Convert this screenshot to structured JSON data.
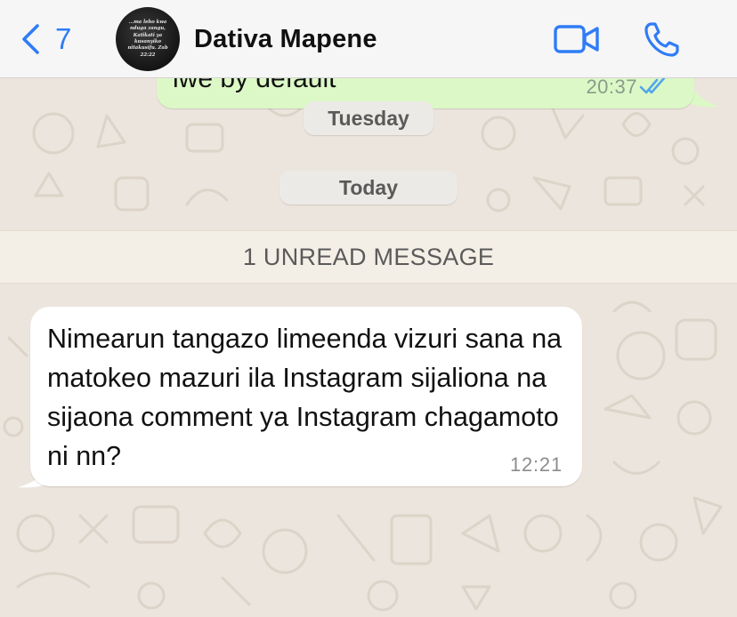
{
  "header": {
    "back_count": "7",
    "contact_name": "Dativa Mapene",
    "avatar_text": "...ma leho kwa nduga zangu, Katikati ya kusanyiko nitakusifu. Zab 22:22"
  },
  "chat": {
    "outgoing_message": {
      "text": "iwe by default",
      "time": "20:37",
      "status": "read"
    },
    "date_separators": [
      "Tuesday",
      "Today"
    ],
    "unread_banner": "1 UNREAD MESSAGE",
    "incoming_message": {
      "text": "Nimearun tangazo limeenda vizuri sana na matokeo mazuri ila Instagram sijaliona na sijaona comment ya Instagram chagamoto ni nn?",
      "time": "12:21"
    }
  },
  "colors": {
    "accent": "#2f7cf6",
    "outgoing_bubble": "#dcf8c6",
    "incoming_bubble": "#ffffff",
    "wallpaper": "#ece5dd",
    "read_ticks": "#53a6e8"
  },
  "icons": {
    "back": "chevron-left-icon",
    "video": "video-camera-icon",
    "call": "phone-icon",
    "read_status": "double-check-icon"
  }
}
